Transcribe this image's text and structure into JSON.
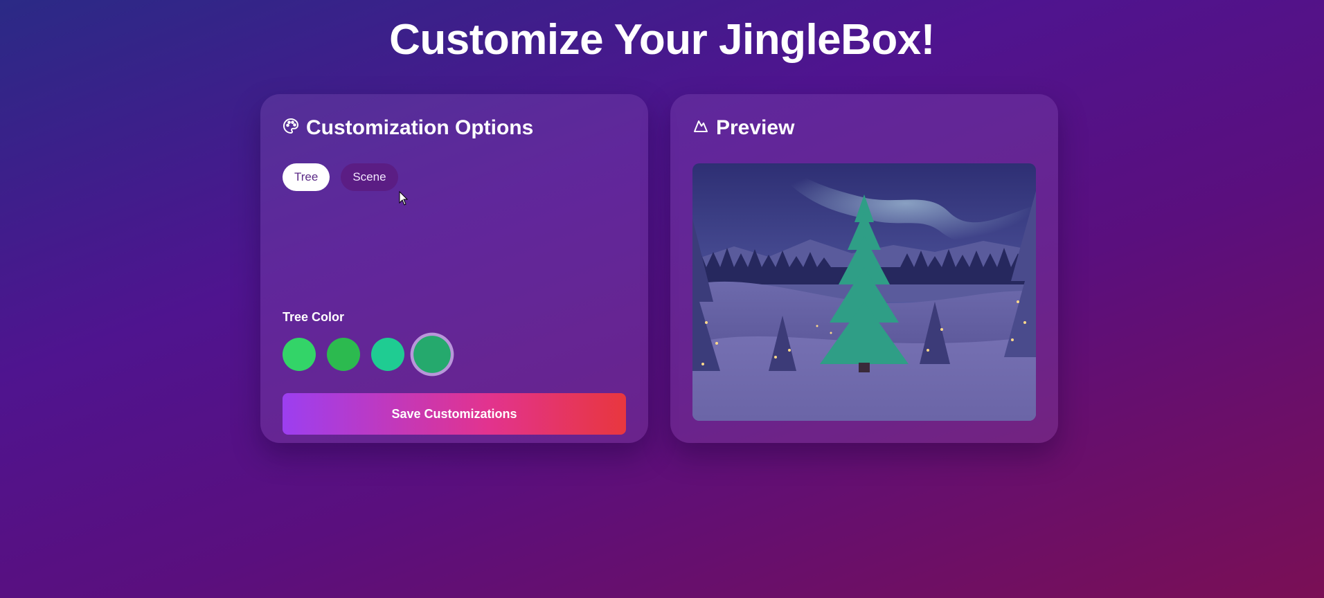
{
  "page": {
    "title": "Customize Your JingleBox!"
  },
  "options_panel": {
    "title": "Customization Options",
    "icon": "palette-icon",
    "tabs": [
      {
        "label": "Tree",
        "active": true
      },
      {
        "label": "Scene",
        "active": false
      }
    ],
    "tree_color": {
      "label": "Tree Color",
      "swatches": [
        {
          "color": "#33d468",
          "selected": false
        },
        {
          "color": "#2cba4f",
          "selected": false
        },
        {
          "color": "#1fcc92",
          "selected": false
        },
        {
          "color": "#25a96d",
          "selected": true
        }
      ]
    },
    "save_button": {
      "label": "Save Customizations"
    }
  },
  "preview_panel": {
    "title": "Preview",
    "icon": "mountain-icon",
    "scene": {
      "tree_color": "#2f9e86",
      "sky": "#3b3f86",
      "aurora": "#b9e7f0"
    }
  },
  "colors": {
    "accent_gradient_start": "#9c3ff0",
    "accent_gradient_end": "#e8373e",
    "tab_active_bg": "#ffffff",
    "tab_inactive_bg": "#5b1d84"
  }
}
